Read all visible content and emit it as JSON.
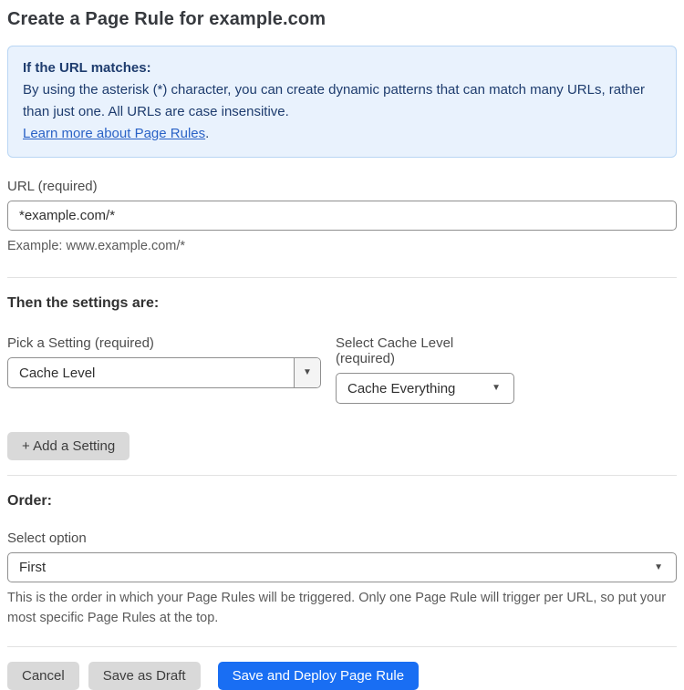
{
  "page": {
    "title": "Create a Page Rule for example.com"
  },
  "info_box": {
    "heading": "If the URL matches:",
    "body": "By using the asterisk (*) character, you can create dynamic patterns that can match many URLs, rather than just one. All URLs are case insensitive.",
    "link_label": "Learn more about Page Rules",
    "link_suffix": "."
  },
  "url_field": {
    "label": "URL (required)",
    "value": "*example.com/*",
    "helper": "Example: www.example.com/*"
  },
  "settings_section": {
    "heading": "Then the settings are:",
    "setting_picker": {
      "label": "Pick a Setting (required)",
      "value": "Cache Level"
    },
    "cache_level_picker": {
      "label": "Select Cache Level (required)",
      "value": "Cache Everything"
    },
    "add_setting_label": "+ Add a Setting"
  },
  "order_section": {
    "heading": "Order:",
    "label": "Select option",
    "value": "First",
    "helper": "This is the order in which your Page Rules will be triggered. Only one Page Rule will trigger per URL, so put your most specific Page Rules at the top."
  },
  "actions": {
    "cancel_label": "Cancel",
    "save_draft_label": "Save as Draft",
    "save_deploy_label": "Save and Deploy Page Rule"
  },
  "icons": {
    "dropdown_arrow": "▼"
  },
  "colors": {
    "accent_blue": "#196ef3",
    "info_background": "#e9f2fd",
    "info_border": "#b9d6f4",
    "info_text": "#1e3c6e",
    "link_blue": "#2a62c6",
    "button_gray": "#d9d9d9",
    "input_border": "#8f8f8f"
  }
}
